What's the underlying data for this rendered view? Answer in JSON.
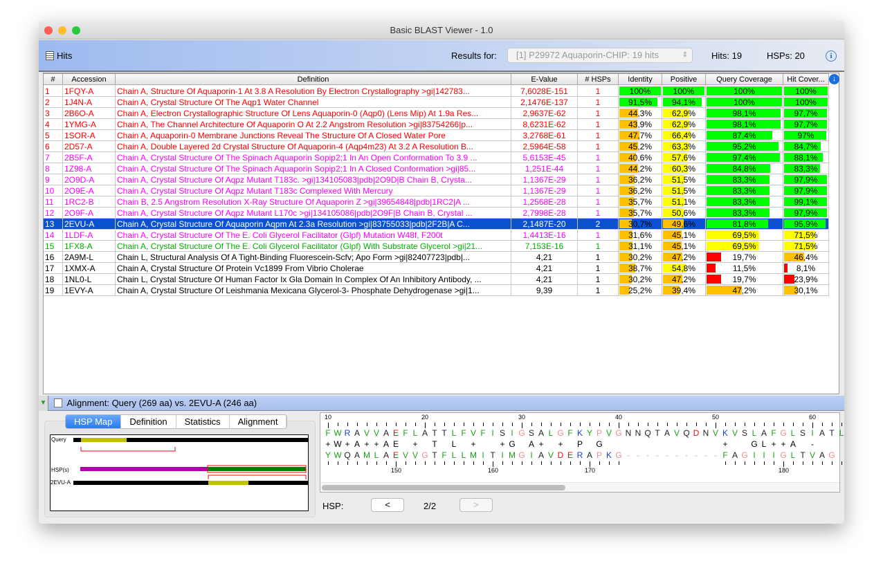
{
  "window": {
    "title": "Basic BLAST Viewer - 1.0"
  },
  "header": {
    "hits_label": "Hits",
    "results_for_label": "Results for:",
    "results_select": "[1] P29972 Aquaporin-CHIP: 19 hits",
    "hits_count": "Hits: 19",
    "hsps_count": "HSPs: 20",
    "info_icon": "info-icon"
  },
  "colors": {
    "red": "#ff0000",
    "magenta": "#ff00ff",
    "green": "#00b000",
    "black": "#000000",
    "selected": "#0c52d0",
    "bar_green": "#00ff00",
    "bar_yellow": "#ffff00",
    "bar_orange": "#ffc000",
    "bar_red": "#ff0000"
  },
  "table": {
    "columns": [
      "#",
      "Accession",
      "Definition",
      "E-Value",
      "# HSPs",
      "Identity",
      "Positive",
      "Query Coverage",
      "Hit Cover..."
    ],
    "selected_row": 13,
    "rows": [
      {
        "n": "1",
        "acc": "1FQY-A",
        "def": "Chain A, Structure Of Aquaporin-1 At 3.8 A Resolution By Electron Crystallography >gi|142783...",
        "e": "7,6028E-151",
        "h": "1",
        "id": "100%",
        "pos": "100%",
        "qc": "100%",
        "hc": "100%",
        "idv": 100,
        "posv": 100,
        "qcv": 100,
        "hcv": 100,
        "color": "red"
      },
      {
        "n": "2",
        "acc": "1J4N-A",
        "def": "Chain A, Crystal Structure Of The Aqp1 Water Channel",
        "e": "2,1476E-137",
        "h": "1",
        "id": "91,5%",
        "pos": "94,1%",
        "qc": "100%",
        "hc": "100%",
        "idv": 91.5,
        "posv": 94.1,
        "qcv": 100,
        "hcv": 100,
        "color": "red"
      },
      {
        "n": "3",
        "acc": "2B6O-A",
        "def": "Chain A, Electron Crystallographic Structure Of Lens Aquaporin-0 (Aqp0) (Lens Mip) At 1.9a Res...",
        "e": "2,9637E-62",
        "h": "1",
        "id": "44,3%",
        "pos": "62,9%",
        "qc": "98,1%",
        "hc": "97,7%",
        "idv": 44.3,
        "posv": 62.9,
        "qcv": 98.1,
        "hcv": 97.7,
        "color": "red"
      },
      {
        "n": "4",
        "acc": "1YMG-A",
        "def": "Chain A, The Channel Architecture Of Aquaporin O At 2.2 Angstrom Resolution >gi|83754266|p...",
        "e": "8,6231E-62",
        "h": "1",
        "id": "43,9%",
        "pos": "62,9%",
        "qc": "98,1%",
        "hc": "97,7%",
        "idv": 43.9,
        "posv": 62.9,
        "qcv": 98.1,
        "hcv": 97.7,
        "color": "red"
      },
      {
        "n": "5",
        "acc": "1SOR-A",
        "def": "Chain A, Aquaporin-0 Membrane Junctions Reveal The Structure Of A Closed Water Pore",
        "e": "3,2768E-61",
        "h": "1",
        "id": "47,7%",
        "pos": "66,4%",
        "qc": "87,4%",
        "hc": "97%",
        "idv": 47.7,
        "posv": 66.4,
        "qcv": 87.4,
        "hcv": 97,
        "color": "red"
      },
      {
        "n": "6",
        "acc": "2D57-A",
        "def": "Chain A, Double Layered 2d Crystal Structure Of Aquaporin-4 (Aqp4m23) At 3.2 A Resolution B...",
        "e": "2,5964E-58",
        "h": "1",
        "id": "45,2%",
        "pos": "63,3%",
        "qc": "95,2%",
        "hc": "84,7%",
        "idv": 45.2,
        "posv": 63.3,
        "qcv": 95.2,
        "hcv": 84.7,
        "color": "red"
      },
      {
        "n": "7",
        "acc": "2B5F-A",
        "def": "Chain A, Crystal Structure Of The Spinach Aquaporin Sopip2;1 In An Open Conformation To 3.9 ...",
        "e": "5,6153E-45",
        "h": "1",
        "id": "40,6%",
        "pos": "57,6%",
        "qc": "97,4%",
        "hc": "88,1%",
        "idv": 40.6,
        "posv": 57.6,
        "qcv": 97.4,
        "hcv": 88.1,
        "color": "magenta"
      },
      {
        "n": "8",
        "acc": "1Z98-A",
        "def": "Chain A, Crystal Structure Of The Spinach Aquaporin Sopip2;1 In A Closed Conformation >gi|85...",
        "e": "1,251E-44",
        "h": "1",
        "id": "44,2%",
        "pos": "60,3%",
        "qc": "84,8%",
        "hc": "83,3%",
        "idv": 44.2,
        "posv": 60.3,
        "qcv": 84.8,
        "hcv": 83.3,
        "color": "magenta"
      },
      {
        "n": "9",
        "acc": "2O9D-A",
        "def": "Chain A, Crystal Structure Of Aqpz Mutant T183c. >gi|134105083|pdb|2O9D|B Chain B, Crysta...",
        "e": "1,1367E-29",
        "h": "1",
        "id": "36,2%",
        "pos": "51,5%",
        "qc": "83,3%",
        "hc": "97,9%",
        "idv": 36.2,
        "posv": 51.5,
        "qcv": 83.3,
        "hcv": 97.9,
        "color": "magenta"
      },
      {
        "n": "10",
        "acc": "2O9E-A",
        "def": "Chain A, Crystal Structure Of Aqpz Mutant T183c Complexed With Mercury",
        "e": "1,1367E-29",
        "h": "1",
        "id": "36,2%",
        "pos": "51,5%",
        "qc": "83,3%",
        "hc": "97,9%",
        "idv": 36.2,
        "posv": 51.5,
        "qcv": 83.3,
        "hcv": 97.9,
        "color": "magenta"
      },
      {
        "n": "11",
        "acc": "1RC2-B",
        "def": "Chain B, 2.5 Angstrom Resolution X-Ray Structure Of Aquaporin Z >gi|39654848|pdb|1RC2|A ...",
        "e": "1,2568E-28",
        "h": "1",
        "id": "35,7%",
        "pos": "51,1%",
        "qc": "83,3%",
        "hc": "99,1%",
        "idv": 35.7,
        "posv": 51.1,
        "qcv": 83.3,
        "hcv": 99.1,
        "color": "magenta"
      },
      {
        "n": "12",
        "acc": "2O9F-A",
        "def": "Chain A, Crystal Structure Of Aqpz Mutant L170c >gi|134105086|pdb|2O9F|B Chain B, Crystal ...",
        "e": "2,7998E-28",
        "h": "1",
        "id": "35,7%",
        "pos": "50,6%",
        "qc": "83,3%",
        "hc": "97,9%",
        "idv": 35.7,
        "posv": 50.6,
        "qcv": 83.3,
        "hcv": 97.9,
        "color": "magenta"
      },
      {
        "n": "13",
        "acc": "2EVU-A",
        "def": "Chain A, Crystal Structure Of Aquaporin Aqpm At 2.3a Resolution >gi|83755033|pdb|2F2B|A C...",
        "e": "2,1487E-20",
        "h": "2",
        "id": "30,7%",
        "pos": "49,6%",
        "qc": "81,8%",
        "hc": "95,9%",
        "idv": 30.7,
        "posv": 49.6,
        "qcv": 81.8,
        "hcv": 95.9,
        "color": "selected"
      },
      {
        "n": "14",
        "acc": "1LDF-A",
        "def": "Chain A, Crystal Structure Of The E. Coli Glycerol Facilitator (Glpf) Mutation W48f, F200t",
        "e": "1,4413E-16",
        "h": "1",
        "id": "31,6%",
        "pos": "45,1%",
        "qc": "69,5%",
        "hc": "71,5%",
        "idv": 31.6,
        "posv": 45.1,
        "qcv": 69.5,
        "hcv": 71.5,
        "color": "magenta"
      },
      {
        "n": "15",
        "acc": "1FX8-A",
        "def": "Chain A, Crystal Structure Of The E. Coli Glycerol Facilitator (Glpf) With Substrate Glycerol >gi|21...",
        "e": "7,153E-16",
        "h": "1",
        "id": "31,1%",
        "pos": "45,1%",
        "qc": "69,5%",
        "hc": "71,5%",
        "idv": 31.1,
        "posv": 45.1,
        "qcv": 69.5,
        "hcv": 71.5,
        "color": "green"
      },
      {
        "n": "16",
        "acc": "2A9M-L",
        "def": "Chain L, Structural Analysis Of A Tight-Binding Fluorescein-Scfv; Apo Form >gi|82407723|pdb|...",
        "e": "4,21",
        "h": "1",
        "id": "30,2%",
        "pos": "47,2%",
        "qc": "19,7%",
        "hc": "46,4%",
        "idv": 30.2,
        "posv": 47.2,
        "qcv": 19.7,
        "hcv": 46.4,
        "color": "black"
      },
      {
        "n": "17",
        "acc": "1XMX-A",
        "def": "Chain A, Crystal Structure Of Protein Vc1899 From Vibrio Cholerae",
        "e": "4,21",
        "h": "1",
        "id": "38,7%",
        "pos": "54,8%",
        "qc": "11,5%",
        "hc": "8,1%",
        "idv": 38.7,
        "posv": 54.8,
        "qcv": 11.5,
        "hcv": 8.1,
        "color": "black"
      },
      {
        "n": "18",
        "acc": "1NL0-L",
        "def": "Chain L, Crystal Structure Of Human Factor Ix Gla Domain In Complex Of An Inhibitory Antibody, ...",
        "e": "4,21",
        "h": "1",
        "id": "30,2%",
        "pos": "47,2%",
        "qc": "19,7%",
        "hc": "23,9%",
        "idv": 30.2,
        "posv": 47.2,
        "qcv": 19.7,
        "hcv": 23.9,
        "color": "black"
      },
      {
        "n": "19",
        "acc": "1EVY-A",
        "def": "Chain A, Crystal Structure Of Leishmania Mexicana Glycerol-3- Phosphate Dehydrogenase >gi|1...",
        "e": "9,39",
        "h": "1",
        "id": "25,2%",
        "pos": "39,4%",
        "qc": "47,2%",
        "hc": "30,1%",
        "idv": 25.2,
        "posv": 39.4,
        "qcv": 47.2,
        "hcv": 30.1,
        "color": "black"
      }
    ]
  },
  "alignment": {
    "title": "Alignment: Query (269 aa) vs. 2EVU-A (246 aa)",
    "tabs": [
      "HSP Map",
      "Definition",
      "Statistics",
      "Alignment"
    ],
    "active_tab": "HSP Map",
    "map_labels": {
      "query": "Query",
      "hsps": "HSP(s)",
      "hit": "2EVU-A"
    },
    "query_seq": "FWRAVVAEFLATTLFVFISIGSALGFKYPVGNNQTAVQDNVKVSLAFGLSIATL",
    "match_line": "+W+A++AE + T L +  +G A+ + P G            +  GL++A -",
    "subject_seq": "YWQAMLAEVVGTFLLMITIMGIAVDERAPKG----------FAGIIIGLTVAG",
    "query_ruler": [
      10,
      20,
      30,
      40,
      50,
      60
    ],
    "subject_ruler": [
      {
        "label": 150,
        "index": 7
      },
      {
        "label": 160,
        "index": 17
      },
      {
        "label": 170,
        "index": 27
      },
      {
        "label": 180,
        "index": 47
      }
    ],
    "hsp_label": "HSP:",
    "prev": "<",
    "next": ">",
    "hsp_page": "2/2"
  }
}
